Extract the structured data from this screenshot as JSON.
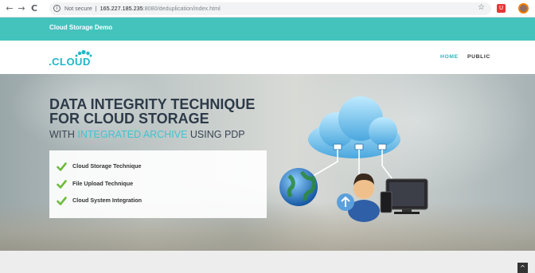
{
  "browser": {
    "back_glyph": "←",
    "forward_glyph": "→",
    "reload_glyph": "C",
    "info_glyph": "i",
    "security_label": "Not secure",
    "separator": "|",
    "url_host": "165.227.185.235",
    "url_path": ":8080/deduplication/index.html",
    "star_glyph": "☆",
    "extension_glyph": "U"
  },
  "site": {
    "top_title": "Cloud Storage Demo",
    "logo_text": ".CLOUD",
    "nav": [
      {
        "label": "HOME",
        "active": true
      },
      {
        "label": "PUBLIC",
        "active": false
      }
    ]
  },
  "hero": {
    "title_line1": "DATA INTEGRITY TECHNIQUE",
    "title_line2": "FOR CLOUD STORAGE",
    "subtitle_pre": "WITH ",
    "subtitle_accent": "INTEGRATED ARCHIVE",
    "subtitle_post": " USING PDP",
    "features": [
      "Cloud Storage Technique",
      "File Upload Technique",
      "Cloud System Integration"
    ]
  },
  "scroll_top_glyph": "^",
  "colors": {
    "teal": "#44c3bd",
    "accent": "#3ec4d0",
    "check_green": "#6cbb3c",
    "title_dark": "#2d3a48"
  }
}
